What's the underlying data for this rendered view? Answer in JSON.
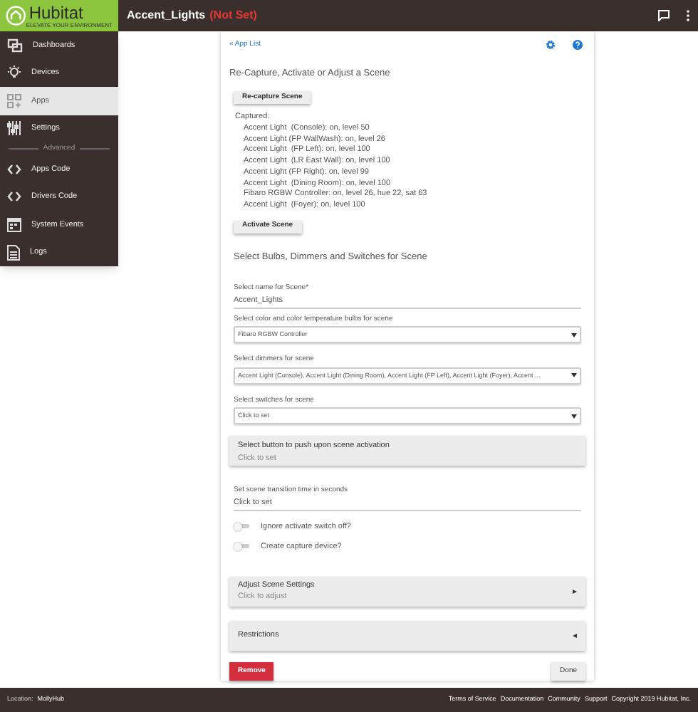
{
  "header": {
    "logo_name": "Hubitat",
    "logo_tagline": "ELEVATE YOUR ENVIRONMENT",
    "title": "Accent_Lights",
    "title_status": "(Not Set)"
  },
  "sidebar": {
    "items": [
      {
        "kind": "item",
        "label": "Dashboards",
        "selected": false
      },
      {
        "kind": "item",
        "label": "Devices",
        "selected": false
      },
      {
        "kind": "item",
        "label": "Apps",
        "selected": true
      },
      {
        "kind": "item",
        "label": "Settings",
        "selected": false
      },
      {
        "kind": "divider",
        "label": "Advanced"
      },
      {
        "kind": "item",
        "label": "Apps Code",
        "selected": false
      },
      {
        "kind": "item",
        "label": "Drivers Code",
        "selected": false
      },
      {
        "kind": "item",
        "label": "System Events",
        "selected": false
      },
      {
        "kind": "item",
        "label": "Logs",
        "selected": false
      }
    ]
  },
  "page": {
    "back_link": "« App List",
    "heading": "Re-Capture, Activate or Adjust a Scene",
    "recapture_button": "Re-capture Scene",
    "captured_label": "Captured:",
    "captured": [
      "Accent Light  (Console): on, level 50",
      "Accent Light (FP WallWash): on, level 26",
      "Accent Light  (FP Left): on, level 100",
      "Accent Light  (LR East Wall): on, level 100",
      "Accent Light (FP Right): on, level 99",
      "Accent Light  (Dining Room): on, level 100",
      "Fibaro RGBW Controller: on, level 26, hue 22, sat 63",
      "Accent Light  (Foyer): on, level 100"
    ],
    "activate_button": "Activate Scene",
    "section_title": "Select Bulbs, Dimmers and Switches for Scene",
    "fields": [
      {
        "kind": "text",
        "label": "Select name for Scene*",
        "value": "Accent_Lights"
      },
      {
        "kind": "select",
        "label": "Select color and color temperature bulbs for scene",
        "value": "Fibaro RGBW Controller"
      },
      {
        "kind": "select",
        "label": "Select dimmers for scene",
        "value": "Accent Light (Console), Accent Light (Dining Room), Accent Light (FP Left), Accent Light (Foyer), Accent ..."
      },
      {
        "kind": "select",
        "label": "Select switches for scene",
        "value": "Click to set"
      },
      {
        "kind": "panel",
        "label": "Select button to push upon scene activation",
        "value": "Click to set"
      },
      {
        "kind": "text",
        "label": "Set scene transition time in seconds",
        "value": "Click to set"
      },
      {
        "kind": "toggle",
        "label": "Ignore activate switch off?",
        "on": false
      },
      {
        "kind": "toggle",
        "label": "Create capture device?",
        "on": false
      }
    ],
    "sections": [
      {
        "title": "Adjust Scene Settings",
        "subtitle": "Click to adjust",
        "expanded": false
      },
      {
        "title": "Restrictions",
        "expanded": true
      }
    ],
    "remove_button": "Remove",
    "done_button": "Done"
  },
  "footer": {
    "location_label": "Location:",
    "location_value": "MollyHub",
    "links": [
      "Terms of Service",
      "Documentation",
      "Community",
      "Support"
    ],
    "copyright": "Copyright 2019 Hubitat, Inc."
  }
}
